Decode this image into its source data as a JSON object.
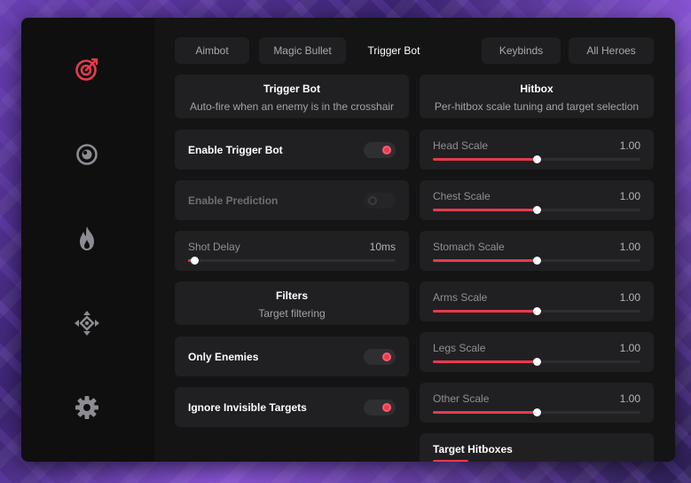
{
  "sidebar": {
    "icons": [
      "target-icon",
      "eye-icon",
      "flame-icon",
      "crosshair-move-icon",
      "gear-icon"
    ]
  },
  "tabs": {
    "aimbot": "Aimbot",
    "magic_bullet": "Magic Bullet",
    "trigger_bot": "Trigger Bot",
    "keybinds": "Keybinds",
    "all_heroes": "All Heroes"
  },
  "left": {
    "trigger_header": {
      "title": "Trigger Bot",
      "subtitle": "Auto-fire when an enemy is in the crosshair"
    },
    "enable_trigger": {
      "label": "Enable Trigger Bot",
      "on": true
    },
    "enable_prediction": {
      "label": "Enable Prediction",
      "on": false
    },
    "shot_delay": {
      "label": "Shot Delay",
      "value": "10ms",
      "fraction": 0.03
    },
    "filters_header": {
      "title": "Filters",
      "subtitle": "Target filtering"
    },
    "only_enemies": {
      "label": "Only Enemies",
      "on": true
    },
    "ignore_invisible": {
      "label": "Ignore Invisible Targets",
      "on": true
    }
  },
  "right": {
    "hitbox_header": {
      "title": "Hitbox",
      "subtitle": "Per-hitbox scale tuning and target selection"
    },
    "head": {
      "label": "Head Scale",
      "value": "1.00",
      "fraction": 0.5
    },
    "chest": {
      "label": "Chest Scale",
      "value": "1.00",
      "fraction": 0.5
    },
    "stomach": {
      "label": "Stomach Scale",
      "value": "1.00",
      "fraction": 0.5
    },
    "arms": {
      "label": "Arms Scale",
      "value": "1.00",
      "fraction": 0.5
    },
    "legs": {
      "label": "Legs Scale",
      "value": "1.00",
      "fraction": 0.5
    },
    "other": {
      "label": "Other Scale",
      "value": "1.00",
      "fraction": 0.5
    },
    "target_hitboxes": {
      "label": "Target Hitboxes"
    }
  },
  "colors": {
    "accent": "#e83a4c",
    "panel": "#202022",
    "window": "#141415"
  }
}
